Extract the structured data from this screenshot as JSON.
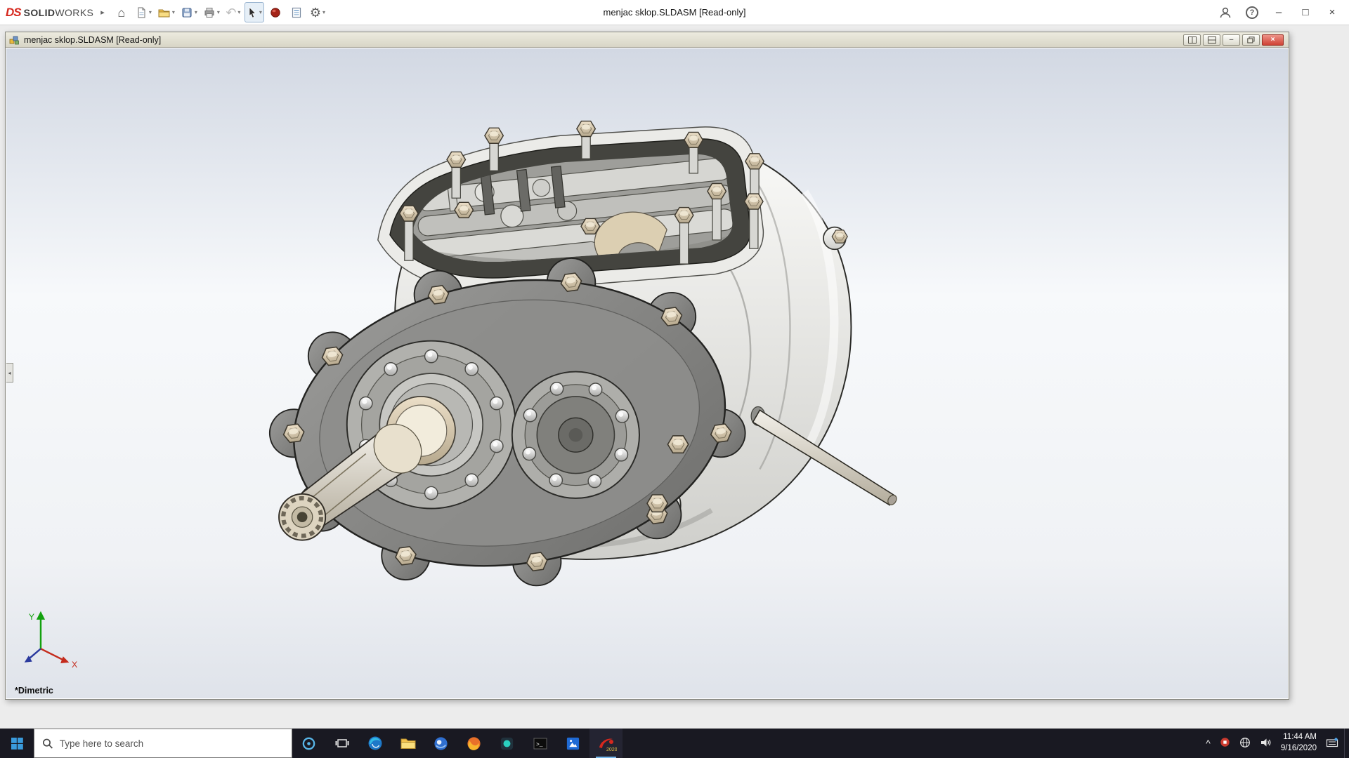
{
  "icons": {
    "caret": "▾",
    "expand": "▸",
    "home": "⌂",
    "undo": "↶",
    "gear": "⚙",
    "minimize": "–",
    "maximize": "□",
    "close": "×",
    "help": "?",
    "tray_expand": "^",
    "panel_collapse": "◂",
    "terminal_glyph": ">_"
  },
  "titlebar": {
    "brand_logo": "DS",
    "brand_bold": "SOLID",
    "brand_light": "WORKS",
    "title": "menjac sklop.SLDASM [Read-only]"
  },
  "doc_window": {
    "title": "menjac sklop.SLDASM [Read-only]",
    "view_orientation": "*Dimetric",
    "triad": {
      "x": "X",
      "y": "Y"
    }
  },
  "taskbar": {
    "search_placeholder": "Type here to search",
    "sw_badge": "2020",
    "clock": {
      "time": "11:44 AM",
      "date": "9/16/2020"
    }
  },
  "colors": {
    "accent_red": "#d6281e",
    "close_red": "#cf4335",
    "taskbar_bg": "#191922",
    "viewport_top": "#d2d8e3",
    "viewport_mid": "#f7f9fb",
    "viewport_bottom": "#dfe3ea"
  }
}
